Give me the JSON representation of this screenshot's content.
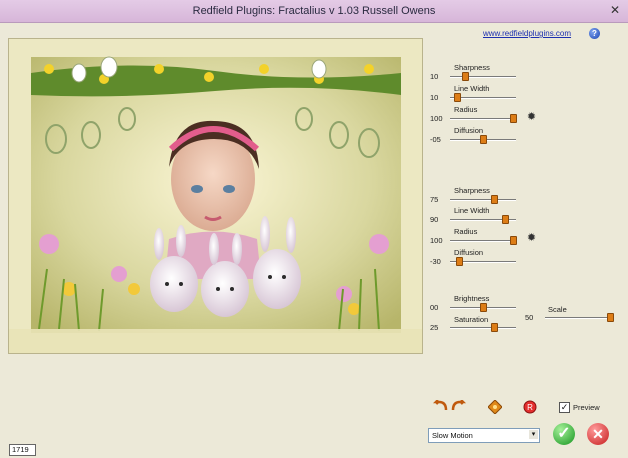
{
  "window": {
    "title": "Redfield Plugins: Fractalius v 1.03   Russell Owens",
    "close_glyph": "✕"
  },
  "header": {
    "link": "www.redfieldplugins.com",
    "help_glyph": "?"
  },
  "group1": {
    "sharpness": {
      "label": "Sharpness",
      "value": "10",
      "level": 0.2
    },
    "line_width": {
      "label": "Line Width",
      "value": "10",
      "level": 0.07
    },
    "radius": {
      "label": "Radius",
      "value": "100",
      "level": 1.0
    },
    "diffusion": {
      "label": "Diffusion",
      "value": "-05",
      "level": 0.5
    }
  },
  "group2": {
    "sharpness": {
      "label": "Sharpness",
      "value": "75",
      "level": 0.68
    },
    "line_width": {
      "label": "Line Width",
      "value": "90",
      "level": 0.87
    },
    "radius": {
      "label": "Radius",
      "value": "100",
      "level": 1.0
    },
    "diffusion": {
      "label": "Diffusion",
      "value": "-30",
      "level": 0.1
    }
  },
  "group3": {
    "brightness": {
      "label": "Brightness",
      "value": "00",
      "level": 0.5
    },
    "saturation": {
      "label": "Saturation",
      "value": "25",
      "level": 0.68
    },
    "scale": {
      "label": "Scale",
      "value": "50",
      "level": 1.0
    }
  },
  "preview": {
    "label": "Preview",
    "checked": "✓"
  },
  "mode_select": {
    "value": "Slow Motion",
    "arrow": "▾"
  },
  "ok_glyph": "✓",
  "cancel_glyph": "✕",
  "status": {
    "value": "1719"
  },
  "colors": {
    "accent": "#dd7d16",
    "title_bg": "#d7b6d9"
  }
}
